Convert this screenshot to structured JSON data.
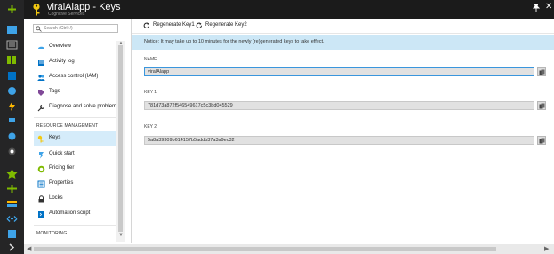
{
  "header": {
    "title": "viralAlapp - Keys",
    "subtitle": "Cognitive Services",
    "pin_icon": "pin-icon",
    "close_icon": "close-icon",
    "close_glyph": "✕",
    "bg_color": "#1b1b1b"
  },
  "rail": {
    "icons": [
      "new-icon",
      "menu-icon",
      "dashboard-icon",
      "resource-groups-icon",
      "all-resources-icon",
      "recent-icon",
      "app-services-icon",
      "functions-icon",
      "sql-icon",
      "cosmos-icon",
      "virtual-machines-icon",
      "load-balancer-icon",
      "storage-icon",
      "network-icon",
      "advisor-icon",
      "more-services-icon"
    ],
    "bg_color": "#252526"
  },
  "menu": {
    "search_placeholder": "Search (Ctrl+/)",
    "items": [
      {
        "label": "Overview",
        "icon": "overview-icon"
      },
      {
        "label": "Activity log",
        "icon": "activity-log-icon"
      },
      {
        "label": "Access control (IAM)",
        "icon": "access-control-icon"
      },
      {
        "label": "Tags",
        "icon": "tag-icon"
      },
      {
        "label": "Diagnose and solve problems",
        "icon": "wrench-icon"
      }
    ],
    "section_resource": "RESOURCE MANAGEMENT",
    "resource_items": [
      {
        "label": "Keys",
        "icon": "key-icon",
        "selected": true
      },
      {
        "label": "Quick start",
        "icon": "quick-start-icon"
      },
      {
        "label": "Pricing tier",
        "icon": "pricing-icon"
      },
      {
        "label": "Properties",
        "icon": "properties-icon"
      },
      {
        "label": "Locks",
        "icon": "lock-icon"
      },
      {
        "label": "Automation script",
        "icon": "automation-icon"
      }
    ],
    "section_monitoring": "MONITORING",
    "selected_color": "#d5ecfa"
  },
  "toolbar": {
    "regen_key1": "Regenerate Key1",
    "regen_key2": "Regenerate Key2"
  },
  "notice": {
    "text": "Notice: It may take up to 10 minutes for the newly (re)generated keys to take effect.",
    "bg_color": "#cce7f6"
  },
  "fields": {
    "name_label": "NAME",
    "name_value": "viralAlapp",
    "key1_label": "KEY 1",
    "key1_value": "781d73a872f546549617c5c3bd045529",
    "key2_label": "KEY 2",
    "key2_value": "5a8a39309b614157b5addb37a3a9ec32"
  }
}
